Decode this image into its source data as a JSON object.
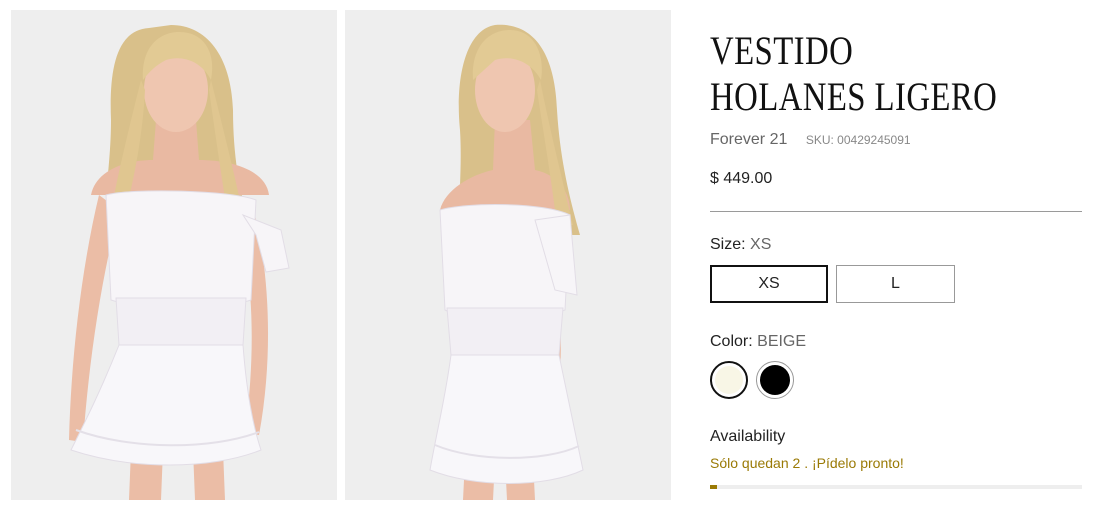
{
  "product": {
    "title": "VESTIDO HOLANES LIGERO",
    "brand": "Forever 21",
    "sku_label": "SKU: 00429245091",
    "price": "$ 449.00"
  },
  "size": {
    "label": "Size:",
    "selected": "XS",
    "options": [
      "XS",
      "L"
    ]
  },
  "color": {
    "label": "Color:",
    "selected": "BEIGE",
    "swatches": [
      {
        "name": "beige",
        "hex": "#f8f6e6"
      },
      {
        "name": "black",
        "hex": "#000000"
      }
    ]
  },
  "availability": {
    "label": "Availability",
    "message": "Sólo quedan 2 . ¡Pídelo pronto!",
    "message_color": "#9a7a05",
    "stock_fraction": 0.02
  },
  "colors": {
    "accent": "#9a7a05",
    "photo_bg": "#eeeeee",
    "dress": "#f6f4f6"
  }
}
